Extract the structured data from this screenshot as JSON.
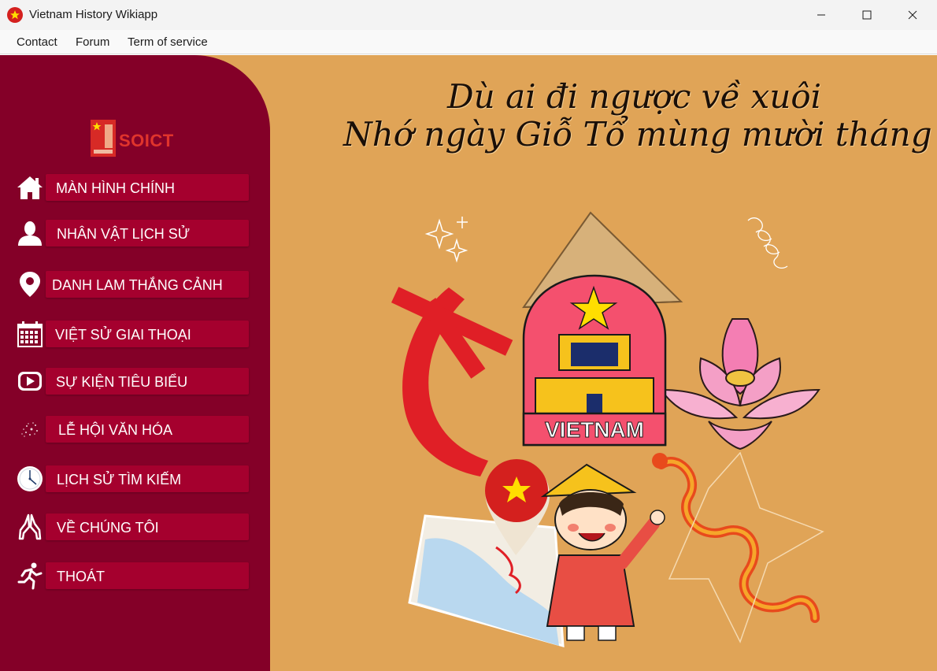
{
  "window": {
    "title": "Vietnam History Wikiapp"
  },
  "menu": {
    "items": [
      "Contact",
      "Forum",
      "Term of service"
    ]
  },
  "sidebar": {
    "logo_text": "SOICT",
    "items": [
      {
        "label": "MÀN HÌNH CHÍNH",
        "icon": "home-icon"
      },
      {
        "label": "NHÂN VẬT LỊCH SỬ",
        "icon": "person-icon"
      },
      {
        "label": "DANH LAM THẮNG CẢNH",
        "icon": "location-pin-icon"
      },
      {
        "label": "VIỆT SỬ GIAI THOẠI",
        "icon": "calendar-icon"
      },
      {
        "label": "SỰ KIỆN TIÊU BIỂU",
        "icon": "video-play-icon"
      },
      {
        "label": "LỄ HỘI VĂN HÓA",
        "icon": "fireworks-icon"
      },
      {
        "label": "LỊCH SỬ TÌM KIẾM",
        "icon": "clock-icon"
      },
      {
        "label": "VỀ CHÚNG TÔI",
        "icon": "praying-hands-icon"
      },
      {
        "label": "THOÁT",
        "icon": "running-man-icon"
      }
    ]
  },
  "main": {
    "poem_line1": "Dù ai đi ngược về xuôi",
    "poem_line2": "Nhớ ngày Giỗ Tổ mùng mười tháng ba",
    "badge_text": "VIETNAM"
  },
  "colors": {
    "sidebar_bg": "#840028",
    "nav_item_bg": "#a5002e",
    "content_bg": "#e0a457",
    "flag_red": "#d4201e",
    "star_yellow": "#ffde00"
  }
}
